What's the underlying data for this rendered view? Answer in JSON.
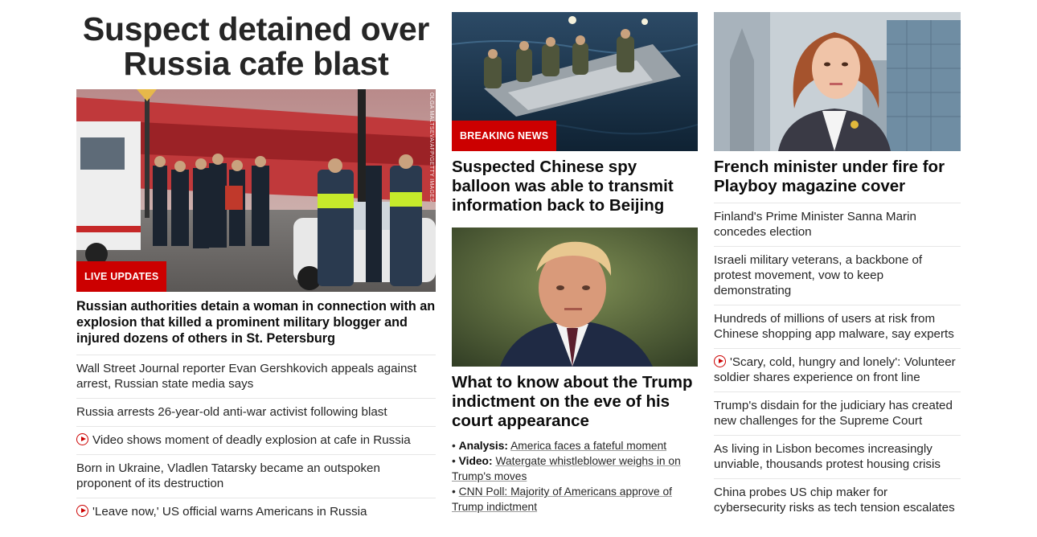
{
  "left": {
    "title": "Suspect detained over Russia cafe blast",
    "image_badge": "LIVE UPDATES",
    "image_credit": "OLGA MALTSEVA/AFP/GETTY IMAGES",
    "headline": "Russian authorities detain a woman in connection with an explosion that killed a prominent military blogger and injured dozens of others in St. Petersburg",
    "items": [
      {
        "text": "Wall Street Journal reporter Evan Gershkovich appeals against arrest, Russian state media says",
        "video": false
      },
      {
        "text": "Russia arrests 26-year-old anti-war activist following blast",
        "video": false
      },
      {
        "text": "Video shows moment of deadly explosion at cafe in Russia",
        "video": true
      },
      {
        "text": "Born in Ukraine, Vladlen Tatarsky became an outspoken proponent of its destruction",
        "video": false
      },
      {
        "text": "'Leave now,' US official warns Americans in Russia",
        "video": true
      }
    ]
  },
  "middle": {
    "story1": {
      "badge": "BREAKING NEWS",
      "headline": "Suspected Chinese spy balloon was able to transmit information back to Beijing"
    },
    "story2": {
      "headline": "What to know about the Trump indictment on the eve of his court appearance",
      "sublinks": [
        {
          "label": "Analysis:",
          "text": "America faces a fateful moment"
        },
        {
          "label": "Video:",
          "text": "Watergate whistleblower weighs in on Trump's moves"
        },
        {
          "label": "",
          "text": "CNN Poll: Majority of Americans approve of Trump indictment"
        }
      ]
    }
  },
  "right": {
    "headline": "French minister under fire for Playboy magazine cover",
    "items": [
      {
        "text": "Finland's Prime Minister Sanna Marin concedes election",
        "video": false
      },
      {
        "text": "Israeli military veterans, a backbone of protest movement, vow to keep demonstrating",
        "video": false
      },
      {
        "text": "Hundreds of millions of users at risk from Chinese shopping app malware, say experts",
        "video": false
      },
      {
        "text": "'Scary, cold, hungry and lonely': Volunteer soldier shares experience on front line",
        "video": true
      },
      {
        "text": "Trump's disdain for the judiciary has created new challenges for the Supreme Court",
        "video": false
      },
      {
        "text": "As living in Lisbon becomes increasingly unviable, thousands protest housing crisis",
        "video": false
      },
      {
        "text": "China probes US chip maker for cybersecurity risks as tech tension escalates",
        "video": false
      }
    ]
  },
  "colors": {
    "accent": "#cc0000",
    "text": "#0c0c0c",
    "divider": "#e6e6e6"
  }
}
